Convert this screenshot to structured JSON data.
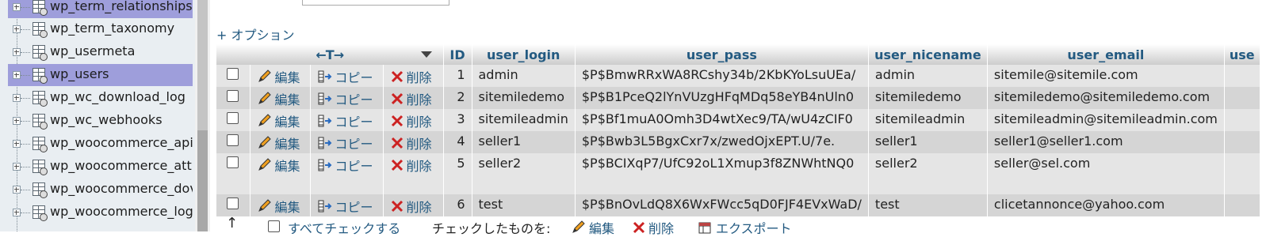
{
  "nav": {
    "items": [
      {
        "label": "wp_term_relationships",
        "selected": true
      },
      {
        "label": "wp_term_taxonomy",
        "selected": false
      },
      {
        "label": "wp_usermeta",
        "selected": false
      },
      {
        "label": "wp_users",
        "selected": true
      },
      {
        "label": "wp_wc_download_log",
        "selected": false
      },
      {
        "label": "wp_wc_webhooks",
        "selected": false
      },
      {
        "label": "wp_woocommerce_api",
        "selected": false
      },
      {
        "label": "wp_woocommerce_att",
        "selected": false
      },
      {
        "label": "wp_woocommerce_dov",
        "selected": false
      },
      {
        "label": "wp_woocommerce_log",
        "selected": false
      }
    ]
  },
  "toolbar": {
    "options_link": "+ オプション"
  },
  "table": {
    "header": {
      "arrows": "←T→",
      "columns": [
        "ID",
        "user_login",
        "user_pass",
        "user_nicename",
        "user_email",
        "use"
      ]
    },
    "actions": {
      "edit": "編集",
      "copy": "コピー",
      "delete": "削除"
    },
    "rows": [
      {
        "id": "1",
        "user_login": "admin",
        "user_pass": "$P$BmwRRxWA8RCshy34b/2KbKYoLsuUEa/",
        "user_nicename": "admin",
        "user_email": "sitemile@sitemile.com"
      },
      {
        "id": "2",
        "user_login": "sitemiledemo",
        "user_pass": "$P$B1PceQ2lYnVUzgHFqMDq58eYB4nUln0",
        "user_nicename": "sitemiledemo",
        "user_email": "sitemiledemo@sitemiledemo.com"
      },
      {
        "id": "3",
        "user_login": "sitemileadmin",
        "user_pass": "$P$Bf1muA0Omh3D4wtXec9/TA/wU4zCIF0",
        "user_nicename": "sitemileadmin",
        "user_email": "sitemileadmin@sitemileadmin.com"
      },
      {
        "id": "4",
        "user_login": "seller1",
        "user_pass": "$P$Bwb3L5BgxCxr7x/zwedOjxEPT.U/7e.",
        "user_nicename": "seller1",
        "user_email": "seller1@seller1.com"
      },
      {
        "id": "5",
        "user_login": "seller2",
        "user_pass": "$P$BCIXqP7/UfC92oL1Xmup3f8ZNWhtNQ0",
        "user_nicename": "seller2",
        "user_email": "seller@sel.com"
      },
      {
        "id": "6",
        "user_login": "test",
        "user_pass": "$P$BnOvLdQ8X6WxFWcc5qD0FJF4EVxWaD/",
        "user_nicename": "test",
        "user_email": "clicetannonce@yahoo.com"
      }
    ]
  },
  "footer": {
    "check_all": "すべてチェックする",
    "with_selected": "チェックしたものを:",
    "edit": "編集",
    "delete": "削除",
    "export": "エクスポート"
  },
  "colors": {
    "link": "#235a81",
    "selected_nav": "#9e9edb",
    "row_odd": "#e5e5e5",
    "row_even": "#d5d5d5",
    "delete_red": "#cc2222"
  }
}
